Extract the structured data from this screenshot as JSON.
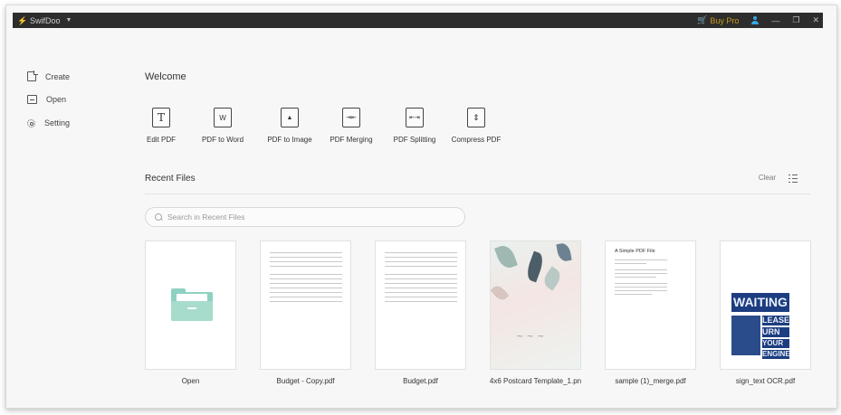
{
  "titlebar": {
    "app_name": "SwifDoo",
    "buy_pro": "Buy Pro",
    "minimize": "—",
    "maximize": "❐",
    "close": "✕"
  },
  "sidebar": {
    "items": [
      {
        "label": "Create",
        "icon": "create-icon"
      },
      {
        "label": "Open",
        "icon": "open-icon"
      },
      {
        "label": "Setting",
        "icon": "gear-icon"
      }
    ]
  },
  "welcome": "Welcome",
  "tools": [
    {
      "label": "Edit PDF",
      "glyph": "T",
      "icon": "edit-pdf-icon"
    },
    {
      "label": "PDF to Word",
      "glyph": "W",
      "icon": "pdf-to-word-icon"
    },
    {
      "label": "PDF to Image",
      "glyph": "▲",
      "icon": "pdf-to-image-icon"
    },
    {
      "label": "PDF Merging",
      "glyph": "⇥⇤",
      "icon": "pdf-merging-icon"
    },
    {
      "label": "PDF Splitting",
      "glyph": "⇤⇥",
      "icon": "pdf-splitting-icon"
    },
    {
      "label": "Compress PDF",
      "glyph": "⇕",
      "icon": "compress-pdf-icon"
    }
  ],
  "recent": {
    "title": "Recent Files",
    "clear": "Clear",
    "search_placeholder": "Search in Recent Files",
    "files": [
      {
        "label": "Open",
        "kind": "folder"
      },
      {
        "label": "Budget - Copy.pdf",
        "kind": "sheet"
      },
      {
        "label": "Budget.pdf",
        "kind": "sheet"
      },
      {
        "label": "4x6 Postcard Template_1.pn",
        "kind": "postcard"
      },
      {
        "label": "sample (1)_merge.pdf",
        "kind": "text",
        "doc_title": "A Simple PDF File"
      },
      {
        "label": "sign_text OCR.pdf",
        "kind": "ocr",
        "ocr_lines": [
          "WAITING",
          "LEASE",
          "URN OFF",
          "YOUR",
          "ENGINE"
        ]
      }
    ]
  }
}
